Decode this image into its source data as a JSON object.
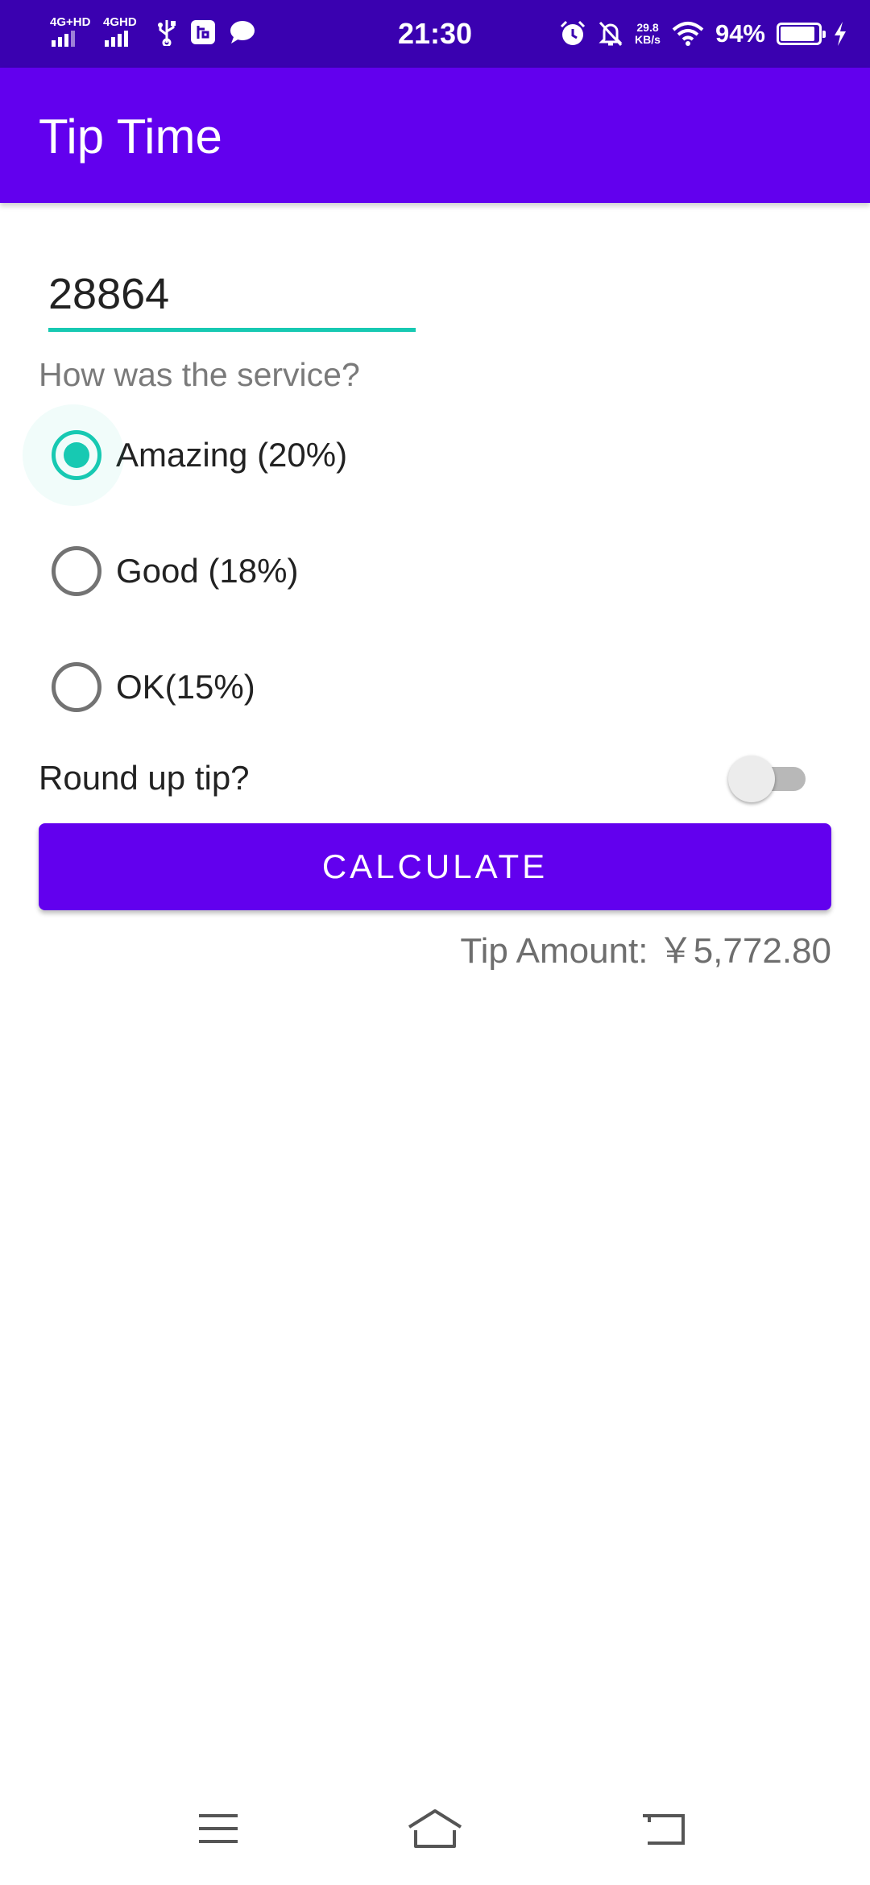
{
  "status_bar": {
    "network_1": "4G+HD",
    "network_2": "4GHD",
    "time": "21:30",
    "speed_value": "29.8",
    "speed_unit": "KB/s",
    "battery": "94%",
    "icons": [
      "signal-icon",
      "usb-icon",
      "app-notification-icon",
      "chat-icon",
      "alarm-icon",
      "mute-icon",
      "wifi-icon",
      "battery-icon",
      "charging-icon"
    ]
  },
  "app_bar": {
    "title": "Tip Time",
    "color": "#6200ee"
  },
  "form": {
    "cost_value": "28864",
    "service_question": "How was the service?",
    "options": [
      {
        "label": "Amazing (20%)",
        "checked": true
      },
      {
        "label": "Good (18%)",
        "checked": false
      },
      {
        "label": "OK(15%)",
        "checked": false
      }
    ],
    "round_up_label": "Round up tip?",
    "round_up_on": false,
    "calculate_label": "CALCULATE",
    "tip_amount": "Tip Amount: ￥5,772.80"
  },
  "colors": {
    "accent": "#17c9b2",
    "primary": "#6200ee",
    "status_bar": "#3a01b0"
  },
  "nav_bar": {
    "icons": [
      "menu-icon",
      "home-icon",
      "back-icon"
    ]
  }
}
